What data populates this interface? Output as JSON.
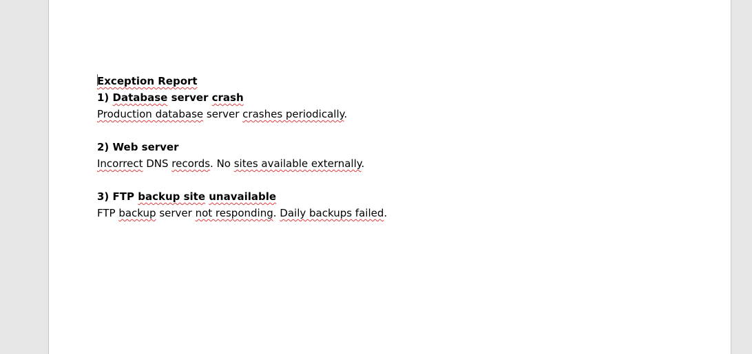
{
  "document": {
    "title": "Exception Report",
    "items": [
      {
        "heading_num": "1) ",
        "heading_a": "Database",
        "heading_b": " server ",
        "heading_c": "crash",
        "body_a": "Production database",
        "body_b": " server ",
        "body_c": "crashes periodically",
        "body_d": "."
      },
      {
        "heading": "2) Web server",
        "body_a": "Incorrect",
        "body_b": " DNS ",
        "body_c": "records",
        "body_d": ". No ",
        "body_e": "sites available externally",
        "body_f": "."
      },
      {
        "heading_a": "3) FTP ",
        "heading_b": "backup site",
        "heading_c": " ",
        "heading_d": "unavailable",
        "body_a": "FTP ",
        "body_b": "backup",
        "body_c": " server ",
        "body_d": "not responding",
        "body_e": ". ",
        "body_f": "Daily backups failed",
        "body_g": "."
      }
    ]
  }
}
